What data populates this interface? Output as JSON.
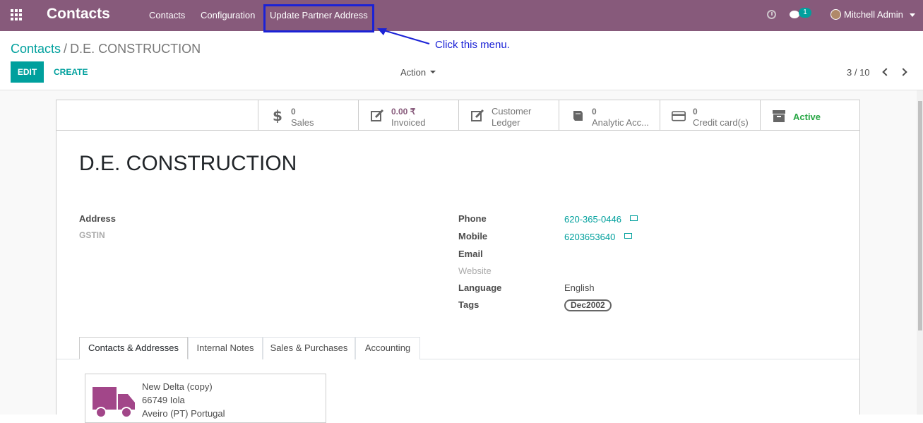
{
  "navbar": {
    "brand": "Contacts",
    "menu": [
      "Contacts",
      "Configuration",
      "Update Partner Address"
    ],
    "chat_count": "1",
    "user": "Mitchell Admin"
  },
  "annotation": {
    "text": "Click this menu."
  },
  "control_panel": {
    "breadcrumb_root": "Contacts",
    "breadcrumb_sep": "/",
    "breadcrumb_current": "D.E. CONSTRUCTION",
    "edit_label": "EDIT",
    "create_label": "CREATE",
    "action_label": "Action",
    "pager": "3 / 10"
  },
  "smart_buttons": [
    {
      "icon": "dollar-icon",
      "value": "0",
      "label": "Sales"
    },
    {
      "icon": "pencil-square-icon",
      "value": "0.00 ₹",
      "label": "Invoiced"
    },
    {
      "icon": "pencil-square-icon",
      "value": "Customer",
      "label": "Ledger"
    },
    {
      "icon": "book-icon",
      "value": "0",
      "label": "Analytic Acc..."
    },
    {
      "icon": "credit-card-icon",
      "value": "0",
      "label": "Credit card(s)"
    },
    {
      "icon": "archive-icon",
      "value": "",
      "label": "Active"
    }
  ],
  "partner": {
    "name": "D.E. CONSTRUCTION",
    "left_fields": {
      "address_label": "Address",
      "gstin_label": "GSTIN"
    },
    "right_fields": {
      "phone_label": "Phone",
      "phone": "620-365-0446",
      "mobile_label": "Mobile",
      "mobile": "6203653640",
      "email_label": "Email",
      "website_label": "Website",
      "language_label": "Language",
      "language": "English",
      "tags_label": "Tags",
      "tag": "Dec2002"
    }
  },
  "tabs": [
    "Contacts & Addresses",
    "Internal Notes",
    "Sales & Purchases",
    "Accounting"
  ],
  "contact_card": {
    "name": "New Delta (copy)",
    "line2": "66749 Iola",
    "line3": "Aveiro (PT) Portugal"
  },
  "colors": {
    "navbar": "#875a7b",
    "accent": "#00a09d",
    "annotation": "#1b22d6"
  }
}
